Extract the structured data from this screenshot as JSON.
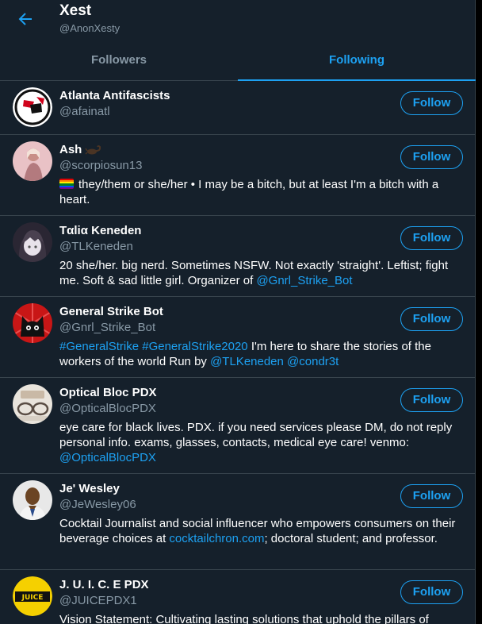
{
  "header": {
    "title": "Xest",
    "handle": "@AnonXesty"
  },
  "tabs": [
    {
      "label": "Followers",
      "active": false
    },
    {
      "label": "Following",
      "active": true
    }
  ],
  "follow_label": "Follow",
  "colors": {
    "background": "#15202b",
    "accent": "#1da1f2",
    "divider": "#38444d",
    "muted": "#8899a6"
  },
  "users": [
    {
      "name": "Atlanta Antifascists",
      "handle": "@afainatl",
      "avatar_icon": "antifa-flag-logo-icon",
      "bio": []
    },
    {
      "name": "Ash",
      "name_emoji": "scorpion-emoji-icon",
      "handle": "@scorpiosun13",
      "avatar_icon": "photo-avatar-icon",
      "bio_prefix_icon": "rainbow-flag-emoji-icon",
      "bio": [
        {
          "text": "they/them or she/her • I may be a bitch, but at least I'm a bitch with a heart.",
          "link": false
        }
      ]
    },
    {
      "name": "Tαliα Keneden",
      "handle": "@TLKeneden",
      "avatar_icon": "anime-avatar-icon",
      "bio": [
        {
          "text": "20 she/her. big nerd. Sometimes NSFW. Not exactly 'straight'. Leftist; fight me. Soft & sad little girl. Organizer of ",
          "link": false
        },
        {
          "text": "@Gnrl_Strike_Bot",
          "link": true
        }
      ]
    },
    {
      "name": "General Strike Bot",
      "handle": "@Gnrl_Strike_Bot",
      "avatar_icon": "black-cat-logo-icon",
      "bio": [
        {
          "text": "#GeneralStrike",
          "link": true
        },
        {
          "text": " ",
          "link": false
        },
        {
          "text": "#GeneralStrike2020",
          "link": true
        },
        {
          "text": " I'm here to share the stories of the workers of the world Run by ",
          "link": false
        },
        {
          "text": "@TLKeneden",
          "link": true
        },
        {
          "text": " ",
          "link": false
        },
        {
          "text": "@condr3t",
          "link": true
        }
      ]
    },
    {
      "name": "Optical Bloc PDX",
      "handle": "@OpticalBlocPDX",
      "avatar_icon": "glasses-avatar-icon",
      "bio": [
        {
          "text": "eye care for black lives. PDX. if you need services please DM, do not reply personal info. exams, glasses, contacts, medical eye care! venmo: ",
          "link": false
        },
        {
          "text": "@OpticalBlocPDX",
          "link": true
        }
      ]
    },
    {
      "name": "Je' Wesley",
      "handle": "@JeWesley06",
      "avatar_icon": "portrait-avatar-icon",
      "bio": [
        {
          "text": "Cocktail Journalist and social influencer who empowers consumers on their beverage choices at ",
          "link": false
        },
        {
          "text": "cocktailchron.com",
          "link": true
        },
        {
          "text": "; doctoral student; and professor.",
          "link": false
        }
      ]
    },
    {
      "name": "J. U. I. C. E PDX",
      "handle": "@JUICEPDX1",
      "avatar_icon": "juice-logo-icon",
      "bio": [
        {
          "text": "Vision Statement: Cultivating lasting solutions that uphold the pillars of",
          "link": false
        }
      ]
    }
  ]
}
